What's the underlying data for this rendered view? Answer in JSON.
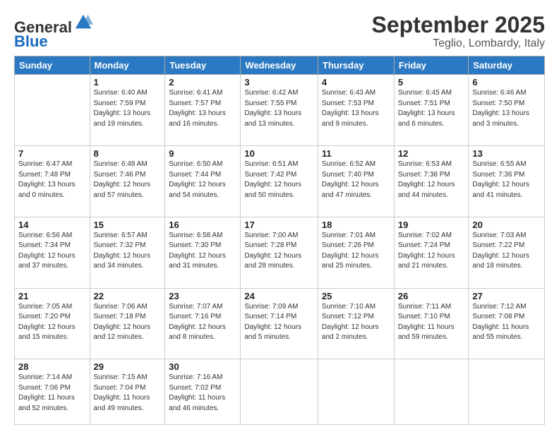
{
  "logo": {
    "general": "General",
    "blue": "Blue"
  },
  "header": {
    "month": "September 2025",
    "location": "Teglio, Lombardy, Italy"
  },
  "days_of_week": [
    "Sunday",
    "Monday",
    "Tuesday",
    "Wednesday",
    "Thursday",
    "Friday",
    "Saturday"
  ],
  "weeks": [
    [
      {
        "day": "",
        "info": ""
      },
      {
        "day": "1",
        "info": "Sunrise: 6:40 AM\nSunset: 7:59 PM\nDaylight: 13 hours\nand 19 minutes."
      },
      {
        "day": "2",
        "info": "Sunrise: 6:41 AM\nSunset: 7:57 PM\nDaylight: 13 hours\nand 16 minutes."
      },
      {
        "day": "3",
        "info": "Sunrise: 6:42 AM\nSunset: 7:55 PM\nDaylight: 13 hours\nand 13 minutes."
      },
      {
        "day": "4",
        "info": "Sunrise: 6:43 AM\nSunset: 7:53 PM\nDaylight: 13 hours\nand 9 minutes."
      },
      {
        "day": "5",
        "info": "Sunrise: 6:45 AM\nSunset: 7:51 PM\nDaylight: 13 hours\nand 6 minutes."
      },
      {
        "day": "6",
        "info": "Sunrise: 6:46 AM\nSunset: 7:50 PM\nDaylight: 13 hours\nand 3 minutes."
      }
    ],
    [
      {
        "day": "7",
        "info": "Sunrise: 6:47 AM\nSunset: 7:48 PM\nDaylight: 13 hours\nand 0 minutes."
      },
      {
        "day": "8",
        "info": "Sunrise: 6:48 AM\nSunset: 7:46 PM\nDaylight: 12 hours\nand 57 minutes."
      },
      {
        "day": "9",
        "info": "Sunrise: 6:50 AM\nSunset: 7:44 PM\nDaylight: 12 hours\nand 54 minutes."
      },
      {
        "day": "10",
        "info": "Sunrise: 6:51 AM\nSunset: 7:42 PM\nDaylight: 12 hours\nand 50 minutes."
      },
      {
        "day": "11",
        "info": "Sunrise: 6:52 AM\nSunset: 7:40 PM\nDaylight: 12 hours\nand 47 minutes."
      },
      {
        "day": "12",
        "info": "Sunrise: 6:53 AM\nSunset: 7:38 PM\nDaylight: 12 hours\nand 44 minutes."
      },
      {
        "day": "13",
        "info": "Sunrise: 6:55 AM\nSunset: 7:36 PM\nDaylight: 12 hours\nand 41 minutes."
      }
    ],
    [
      {
        "day": "14",
        "info": "Sunrise: 6:56 AM\nSunset: 7:34 PM\nDaylight: 12 hours\nand 37 minutes."
      },
      {
        "day": "15",
        "info": "Sunrise: 6:57 AM\nSunset: 7:32 PM\nDaylight: 12 hours\nand 34 minutes."
      },
      {
        "day": "16",
        "info": "Sunrise: 6:58 AM\nSunset: 7:30 PM\nDaylight: 12 hours\nand 31 minutes."
      },
      {
        "day": "17",
        "info": "Sunrise: 7:00 AM\nSunset: 7:28 PM\nDaylight: 12 hours\nand 28 minutes."
      },
      {
        "day": "18",
        "info": "Sunrise: 7:01 AM\nSunset: 7:26 PM\nDaylight: 12 hours\nand 25 minutes."
      },
      {
        "day": "19",
        "info": "Sunrise: 7:02 AM\nSunset: 7:24 PM\nDaylight: 12 hours\nand 21 minutes."
      },
      {
        "day": "20",
        "info": "Sunrise: 7:03 AM\nSunset: 7:22 PM\nDaylight: 12 hours\nand 18 minutes."
      }
    ],
    [
      {
        "day": "21",
        "info": "Sunrise: 7:05 AM\nSunset: 7:20 PM\nDaylight: 12 hours\nand 15 minutes."
      },
      {
        "day": "22",
        "info": "Sunrise: 7:06 AM\nSunset: 7:18 PM\nDaylight: 12 hours\nand 12 minutes."
      },
      {
        "day": "23",
        "info": "Sunrise: 7:07 AM\nSunset: 7:16 PM\nDaylight: 12 hours\nand 8 minutes."
      },
      {
        "day": "24",
        "info": "Sunrise: 7:09 AM\nSunset: 7:14 PM\nDaylight: 12 hours\nand 5 minutes."
      },
      {
        "day": "25",
        "info": "Sunrise: 7:10 AM\nSunset: 7:12 PM\nDaylight: 12 hours\nand 2 minutes."
      },
      {
        "day": "26",
        "info": "Sunrise: 7:11 AM\nSunset: 7:10 PM\nDaylight: 11 hours\nand 59 minutes."
      },
      {
        "day": "27",
        "info": "Sunrise: 7:12 AM\nSunset: 7:08 PM\nDaylight: 11 hours\nand 55 minutes."
      }
    ],
    [
      {
        "day": "28",
        "info": "Sunrise: 7:14 AM\nSunset: 7:06 PM\nDaylight: 11 hours\nand 52 minutes."
      },
      {
        "day": "29",
        "info": "Sunrise: 7:15 AM\nSunset: 7:04 PM\nDaylight: 11 hours\nand 49 minutes."
      },
      {
        "day": "30",
        "info": "Sunrise: 7:16 AM\nSunset: 7:02 PM\nDaylight: 11 hours\nand 46 minutes."
      },
      {
        "day": "",
        "info": ""
      },
      {
        "day": "",
        "info": ""
      },
      {
        "day": "",
        "info": ""
      },
      {
        "day": "",
        "info": ""
      }
    ]
  ]
}
